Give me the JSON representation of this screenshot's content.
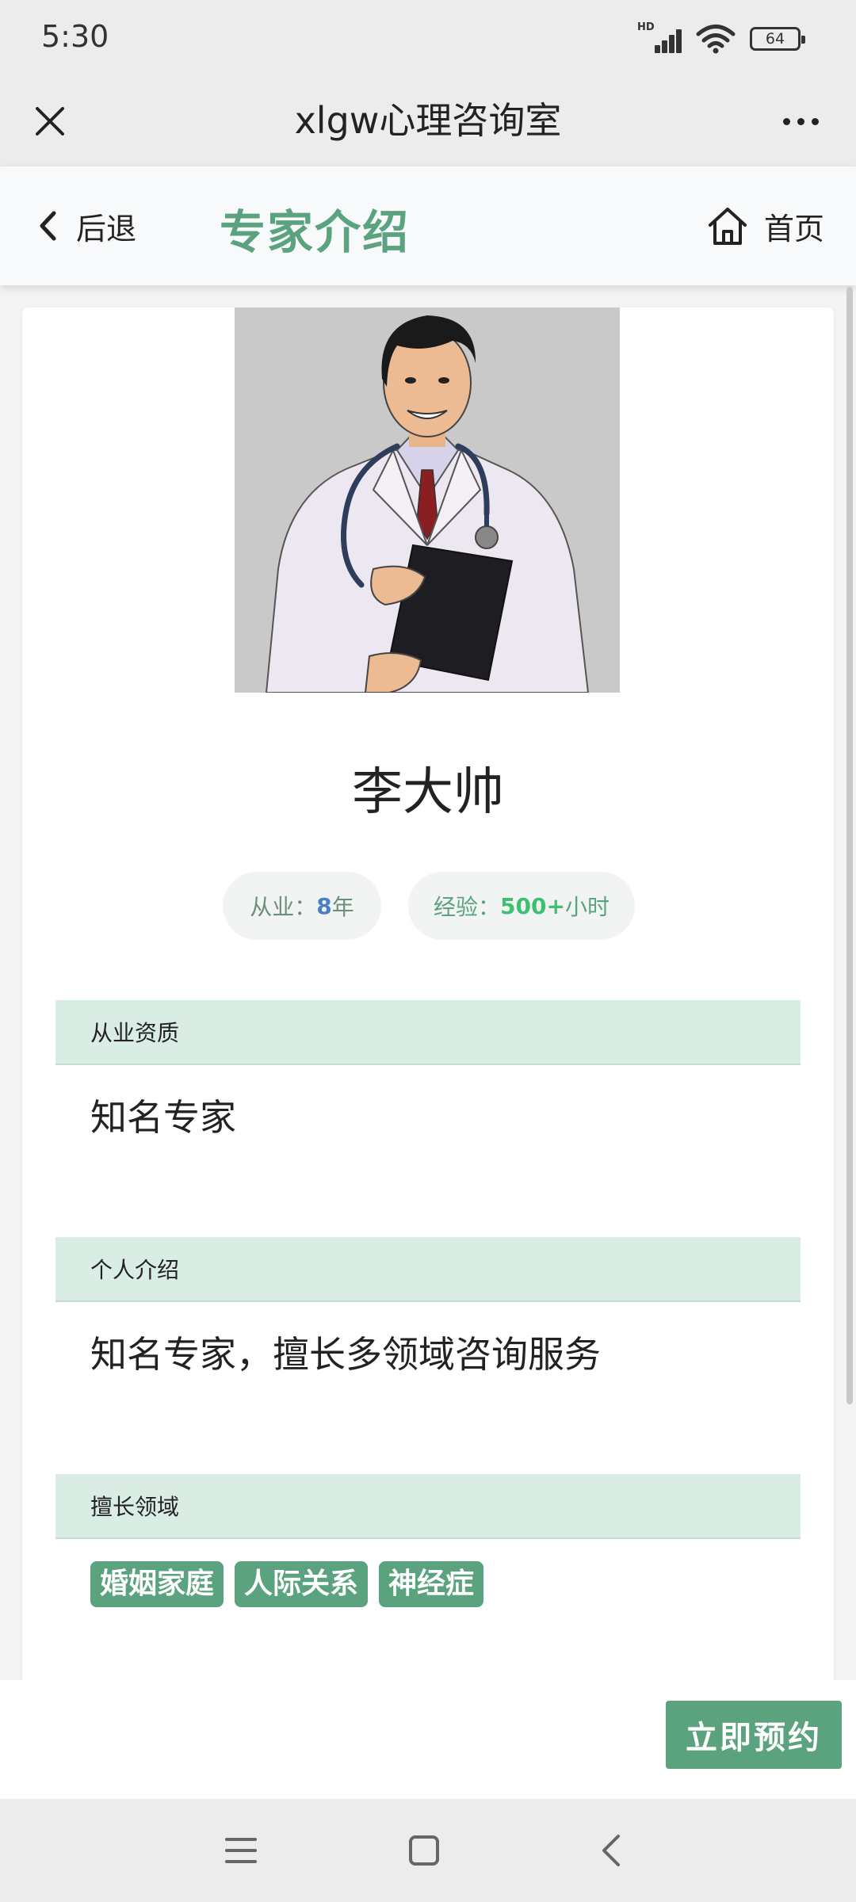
{
  "status_bar": {
    "time": "5:30",
    "network": "HD",
    "battery": "64",
    "icons": [
      "signal-icon",
      "wifi-icon",
      "battery-icon"
    ]
  },
  "webview": {
    "title": "xlgw心理咨询室",
    "close_icon": "close-icon",
    "more_icon": "more-icon"
  },
  "header": {
    "back_label": "后退",
    "title": "专家介绍",
    "home_label": "首页"
  },
  "expert": {
    "name": "李大帅",
    "stats": {
      "years_key": "从业：",
      "years_value": "8",
      "years_unit": "年",
      "exp_key": "经验：",
      "exp_value": "500+",
      "exp_unit": "小时"
    },
    "sections": [
      {
        "title": "从业资质",
        "content": "知名专家"
      },
      {
        "title": "个人介绍",
        "content": "知名专家，擅长多领域咨询服务"
      },
      {
        "title": "擅长领域"
      }
    ],
    "tags": [
      "婚姻家庭",
      "人际关系",
      "神经症"
    ]
  },
  "action": {
    "book_label": "立即预约"
  },
  "colors": {
    "accent": "#5aa37e",
    "section_bg": "#daede5",
    "years_value": "#4a7fc1",
    "exp_value": "#3ebf72"
  }
}
